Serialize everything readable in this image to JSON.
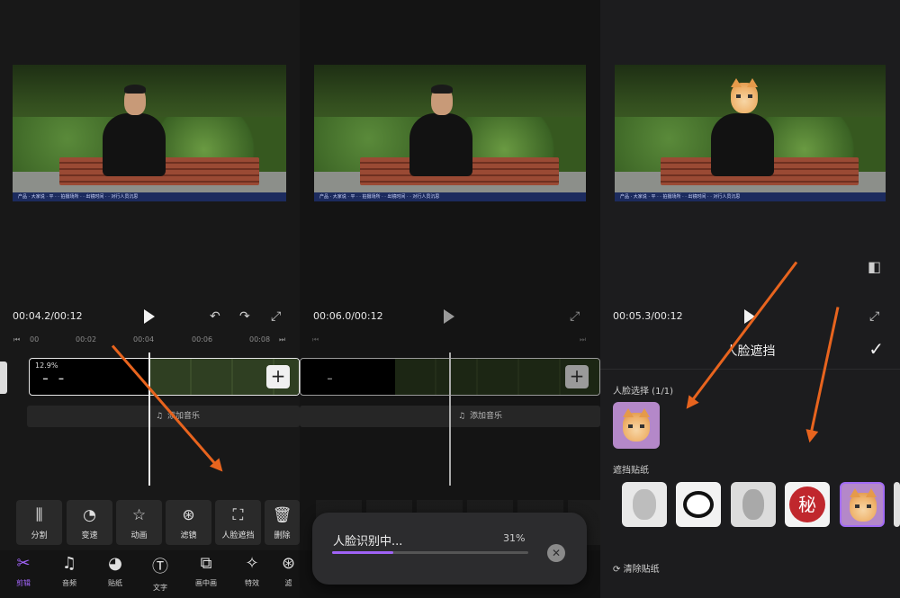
{
  "panel1": {
    "timecode": "00:04.2/00:12",
    "ruler": [
      "00",
      "00:02",
      "00:04",
      "00:06",
      "00:08"
    ],
    "clip_label": "12.9%",
    "music_label": "添加音乐",
    "tools": [
      {
        "icon": "split-icon",
        "glyph": "⫼",
        "label": "分割"
      },
      {
        "icon": "speed-icon",
        "glyph": "◔",
        "label": "变速"
      },
      {
        "icon": "animation-icon",
        "glyph": "☆",
        "label": "动画"
      },
      {
        "icon": "filter-icon",
        "glyph": "⊛",
        "label": "滤镜"
      },
      {
        "icon": "face-mask-icon",
        "glyph": "⛶",
        "label": "人脸遮挡"
      },
      {
        "icon": "delete-icon",
        "glyph": "🗑",
        "label": "删除"
      }
    ],
    "nav": [
      {
        "icon": "scissors-icon",
        "glyph": "✂",
        "label": "剪辑"
      },
      {
        "icon": "music-icon",
        "glyph": "♫",
        "label": "音频"
      },
      {
        "icon": "sticker-icon",
        "glyph": "◕",
        "label": "贴纸"
      },
      {
        "icon": "text-icon",
        "glyph": "Ⓣ",
        "label": "文字"
      },
      {
        "icon": "pip-icon",
        "glyph": "⧉",
        "label": "画中画"
      },
      {
        "icon": "effects-icon",
        "glyph": "✧",
        "label": "特效"
      },
      {
        "icon": "filter-nav-icon",
        "glyph": "⊛",
        "label": "滤"
      }
    ]
  },
  "panel2": {
    "timecode": "00:06.0/00:12",
    "music_label": "添加音乐",
    "toast": {
      "title": "人脸识别中...",
      "percent_label": "31%",
      "progress": 0.31
    }
  },
  "panel3": {
    "timecode": "00:05.3/00:12",
    "sheet_title": "人脸遮挡",
    "face_select_label": "人脸选择 (1/1)",
    "sticker_section_label": "遮挡贴纸",
    "secret_sticker_text": "秘",
    "clear_label": "清除贴纸"
  },
  "colors": {
    "accent": "#a063f6",
    "arrow": "#e8641e",
    "background": "#141414"
  }
}
